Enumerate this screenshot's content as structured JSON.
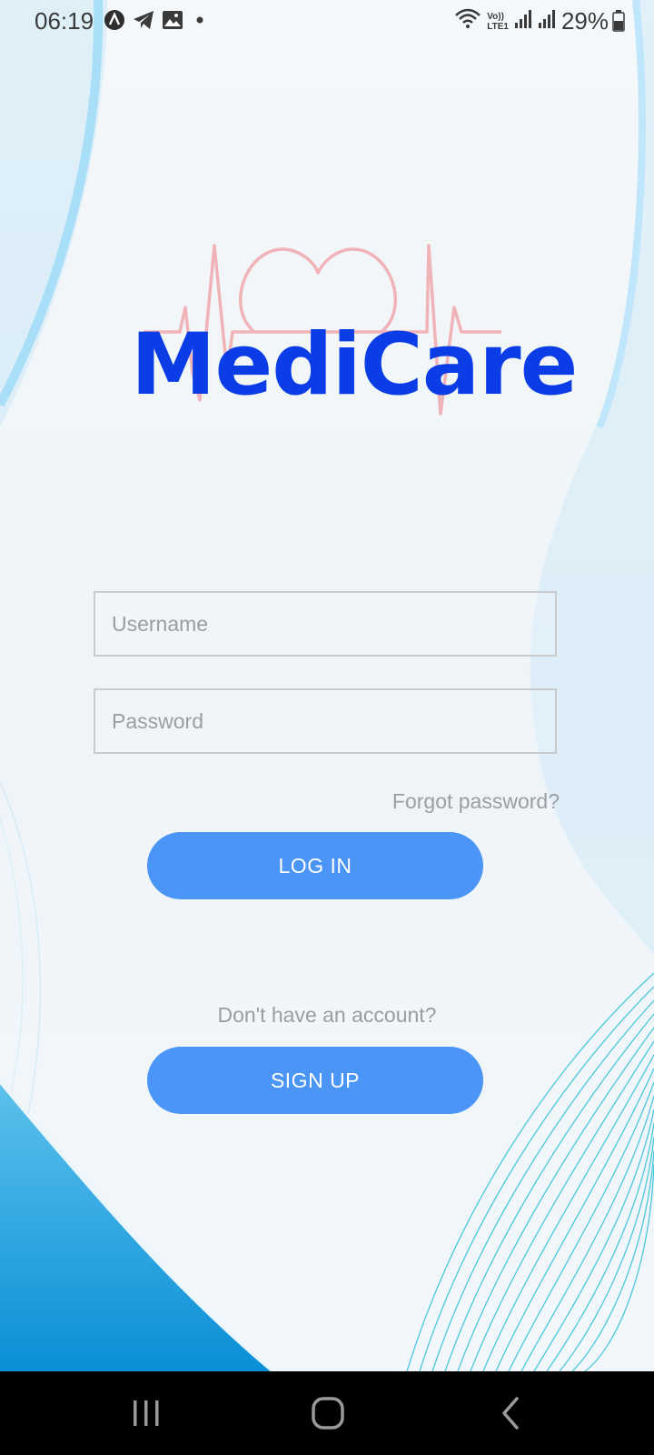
{
  "status_bar": {
    "time": "06:19",
    "battery": "29%",
    "left_icons": [
      "app-a-icon",
      "telegram-icon",
      "gallery-icon",
      "dot-icon"
    ],
    "right_icons": [
      "wifi-icon",
      "volte-lte-icon",
      "signal-icon",
      "signal-icon",
      "battery-icon"
    ],
    "volte_top": "Vo))",
    "volte_bottom": "LTE1"
  },
  "logo": {
    "text": "MediCare",
    "color": "#0a3de6",
    "pulse_color": "#f0b4b8"
  },
  "form": {
    "username_placeholder": "Username",
    "password_placeholder": "Password",
    "forgot_label": "Forgot password?",
    "login_label": "LOG IN",
    "no_account_label": "Don't have an account?",
    "signup_label": "SIGN UP"
  },
  "colors": {
    "button": "#4a95f5",
    "muted_text": "#9a9ea2"
  },
  "nav_bar": {
    "buttons": [
      "recents-icon",
      "home-icon",
      "back-icon"
    ]
  }
}
